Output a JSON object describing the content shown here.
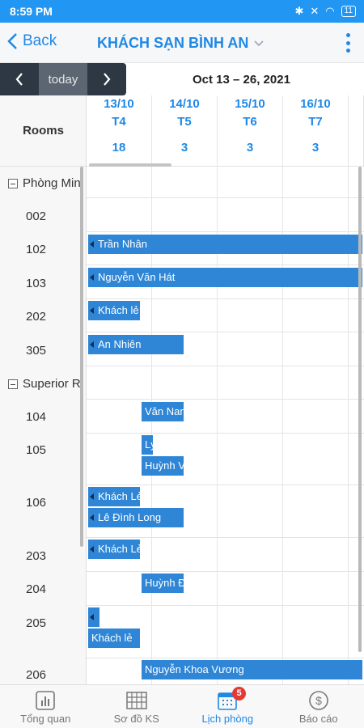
{
  "status": {
    "time": "8:59 PM",
    "battery": "11"
  },
  "appbar": {
    "back_label": "Back",
    "title": "KHÁCH SẠN BÌNH AN"
  },
  "nav": {
    "today_label": "today",
    "range": "Oct 13 – 26, 2021"
  },
  "calendar": {
    "rooms_header": "Rooms",
    "days": [
      {
        "date": "13/10",
        "weekday": "T4",
        "count": "18"
      },
      {
        "date": "14/10",
        "weekday": "T5",
        "count": "3"
      },
      {
        "date": "15/10",
        "weekday": "T6",
        "count": "3"
      },
      {
        "date": "16/10",
        "weekday": "T7",
        "count": "3"
      }
    ],
    "groups": [
      {
        "label": "Phòng Mini"
      },
      {
        "label": "Superior R"
      }
    ],
    "rooms": [
      "002",
      "102",
      "103",
      "202",
      "305",
      "104",
      "105",
      "106",
      "203",
      "204",
      "205",
      "206"
    ],
    "events": [
      "Trần Nhân",
      "Nguyễn Văn Hát",
      "Khách lẻ",
      "An Nhiên",
      "Văn Nam",
      "Lý",
      "Huỳnh Văn",
      "Khách Lẻ",
      "Lê Đình Long",
      "Khách Lẻ",
      "Huỳnh Đức",
      "",
      "Khách lẻ",
      "Nguyễn Khoa Vương"
    ]
  },
  "tabs": [
    {
      "label": "Tổng quan",
      "icon": "chart-icon"
    },
    {
      "label": "Sơ đồ KS",
      "icon": "grid-icon"
    },
    {
      "label": "Lịch phòng",
      "icon": "calendar-icon",
      "badge": "5"
    },
    {
      "label": "Báo cáo",
      "icon": "dollar-icon"
    }
  ]
}
